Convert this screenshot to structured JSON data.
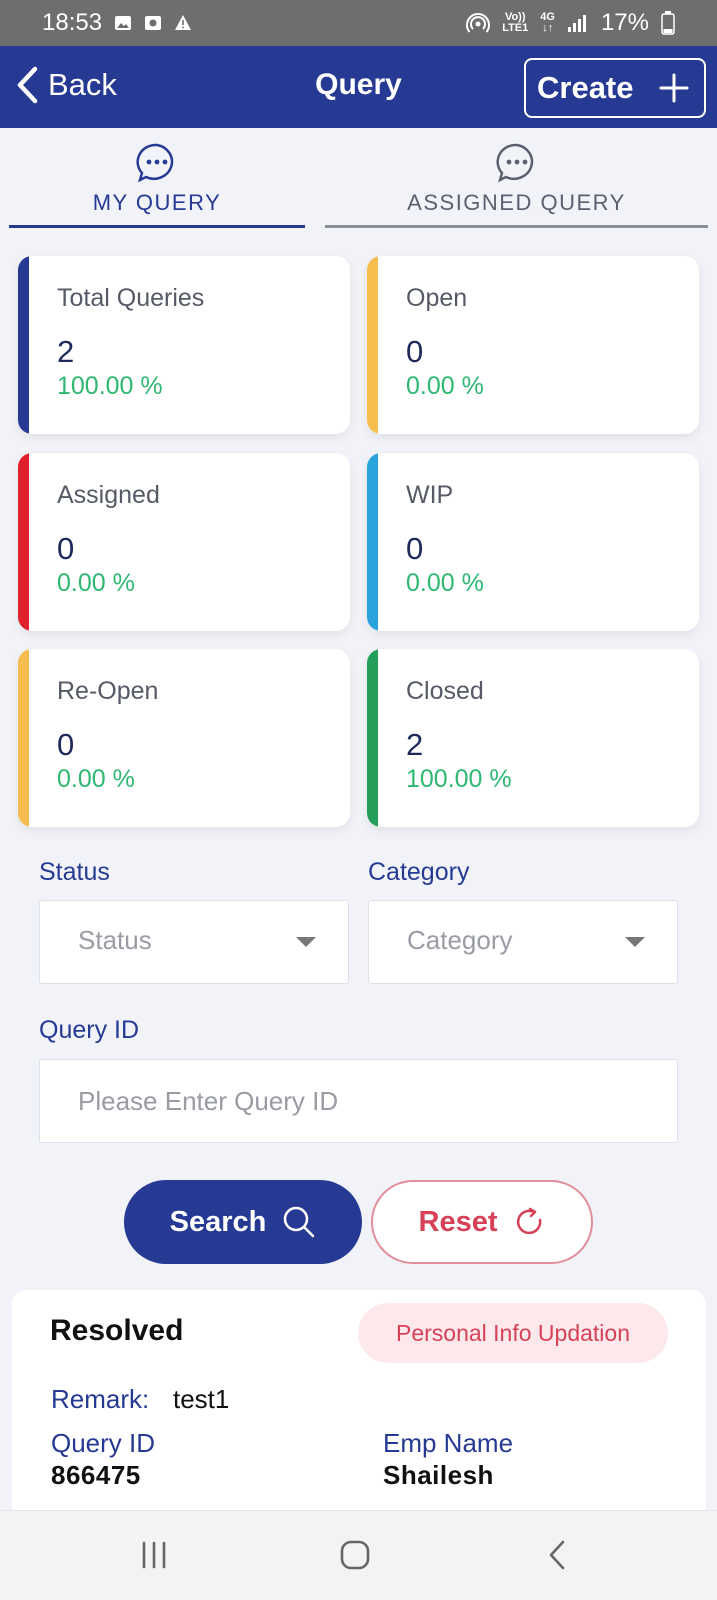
{
  "status_bar": {
    "time": "18:53",
    "network_small_top": "Vo))",
    "network_small_bottom": "LTE1",
    "network_type": "4G",
    "battery": "17%",
    "icons": [
      "image-icon",
      "screen-record-icon",
      "alert-icon",
      "hotspot-icon",
      "signal-icon",
      "battery-icon"
    ]
  },
  "header": {
    "back_label": "Back",
    "title": "Query",
    "create_label": "Create"
  },
  "tabs": [
    {
      "label": "MY QUERY",
      "active": true
    },
    {
      "label": "ASSIGNED QUERY",
      "active": false
    }
  ],
  "cards": [
    {
      "label": "Total Queries",
      "count": "2",
      "percent": "100.00 %",
      "color": "#263a94"
    },
    {
      "label": "Open",
      "count": "0",
      "percent": "0.00 %",
      "color": "#f7bd4f"
    },
    {
      "label": "Assigned",
      "count": "0",
      "percent": "0.00 %",
      "color": "#e0202b"
    },
    {
      "label": "WIP",
      "count": "0",
      "percent": "0.00 %",
      "color": "#2aa3dc"
    },
    {
      "label": "Re-Open",
      "count": "0",
      "percent": "0.00 %",
      "color": "#f7bd4f"
    },
    {
      "label": "Closed",
      "count": "2",
      "percent": "100.00 %",
      "color": "#24a05a"
    }
  ],
  "filters": {
    "status_label": "Status",
    "status_placeholder": "Status",
    "category_label": "Category",
    "category_placeholder": "Category",
    "query_id_label": "Query ID",
    "query_id_placeholder": "Please Enter Query ID"
  },
  "actions": {
    "search_label": "Search",
    "reset_label": "Reset"
  },
  "result": {
    "status": "Resolved",
    "category_badge": "Personal Info Updation",
    "remark_label": "Remark:",
    "remark_value": "test1",
    "query_id_label": "Query ID",
    "query_id_value": "866475",
    "emp_name_label": "Emp Name",
    "emp_name_value": "Shailesh"
  },
  "colors": {
    "primary": "#263a94",
    "success": "#2eb872",
    "danger": "#d64158"
  }
}
